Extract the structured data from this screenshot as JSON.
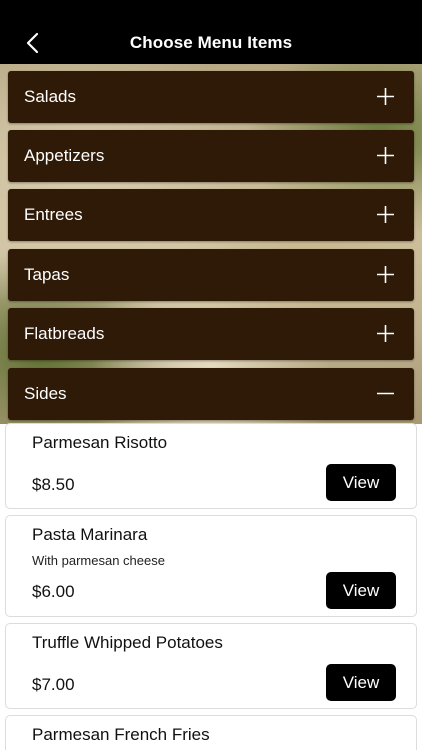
{
  "header": {
    "title": "Choose Menu Items",
    "back_icon": "chevron-left-icon"
  },
  "categories": [
    {
      "label": "Salads",
      "icon": "plus-icon",
      "expanded": false
    },
    {
      "label": "Appetizers",
      "icon": "plus-icon",
      "expanded": false
    },
    {
      "label": "Entrees",
      "icon": "plus-icon",
      "expanded": false
    },
    {
      "label": "Tapas",
      "icon": "plus-icon",
      "expanded": false
    },
    {
      "label": "Flatbreads",
      "icon": "plus-icon",
      "expanded": false
    },
    {
      "label": "Sides",
      "icon": "minus-icon",
      "expanded": true
    }
  ],
  "items": [
    {
      "name": "Parmesan Risotto",
      "description": "",
      "price": "$8.50",
      "button": "View"
    },
    {
      "name": "Pasta Marinara",
      "description": "With parmesan cheese",
      "price": "$6.00",
      "button": "View"
    },
    {
      "name": "Truffle Whipped Potatoes",
      "description": "",
      "price": "$7.00",
      "button": "View"
    },
    {
      "name": "Parmesan French Fries",
      "description": "",
      "price": "",
      "button": ""
    }
  ],
  "colors": {
    "header_bg": "#000000",
    "category_bg": "#2e1a07",
    "button_bg": "#000000",
    "text": "#111111"
  }
}
